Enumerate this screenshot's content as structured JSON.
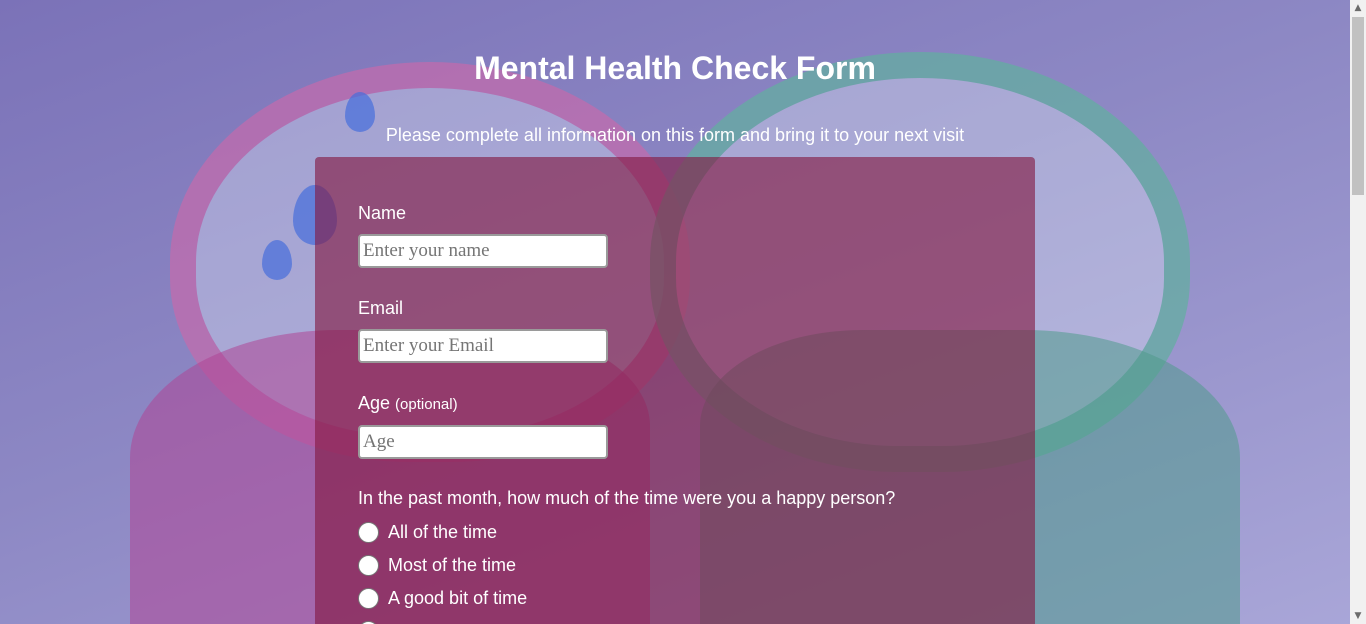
{
  "header": {
    "title": "Mental Health Check Form",
    "subtitle": "Please complete all information on this form and bring it to your next visit"
  },
  "form": {
    "name": {
      "label": "Name",
      "placeholder": "Enter your name",
      "value": ""
    },
    "email": {
      "label": "Email",
      "placeholder": "Enter your Email",
      "value": ""
    },
    "age": {
      "label": "Age",
      "optional_note": "(optional)",
      "placeholder": "Age",
      "value": ""
    },
    "question": {
      "text": "In the past month, how much of the time were you a happy person?",
      "options": [
        "All of the time",
        "Most of the time",
        "A good bit of time"
      ],
      "selected": null
    }
  },
  "colors": {
    "panel": "#82193f",
    "text": "#ffffff",
    "background": "#8d88c4"
  }
}
